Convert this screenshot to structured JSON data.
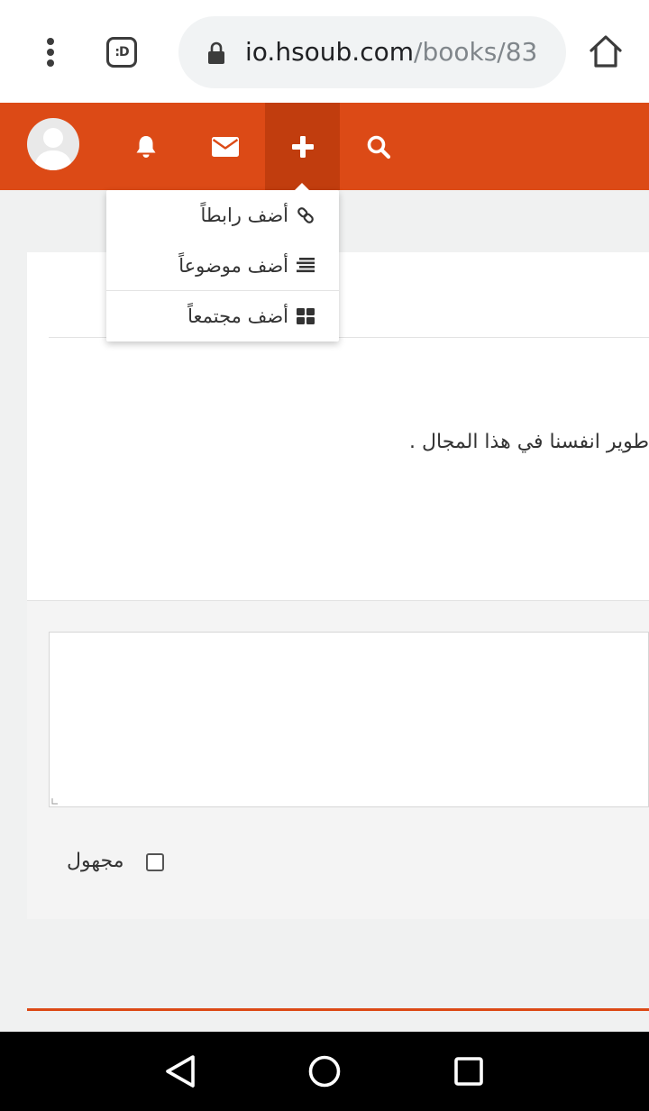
{
  "browser": {
    "tab_switcher_label": ":D",
    "url_host": "io.hsoub.com",
    "url_path": "/books/83"
  },
  "header": {
    "icons": [
      "avatar",
      "bell-icon",
      "mail-icon",
      "plus-icon",
      "search-icon"
    ],
    "accent_color": "#dc4a16",
    "active_accent_color": "#c13d0e"
  },
  "dropdown": {
    "items": [
      {
        "label": "أضف رابطاً",
        "icon": "link-icon"
      },
      {
        "label": "أضف موضوعاً",
        "icon": "list-icon"
      },
      {
        "label": "أضف مجتمعاً",
        "icon": "grid-icon"
      }
    ]
  },
  "content": {
    "body_text": "طوير انفسنا في هذا المجال ."
  },
  "comment": {
    "textarea_value": "",
    "anonymous_label": "مجهول",
    "anonymous_checked": false
  },
  "nav": {
    "buttons": [
      "back-icon",
      "home-icon",
      "recents-icon"
    ]
  }
}
